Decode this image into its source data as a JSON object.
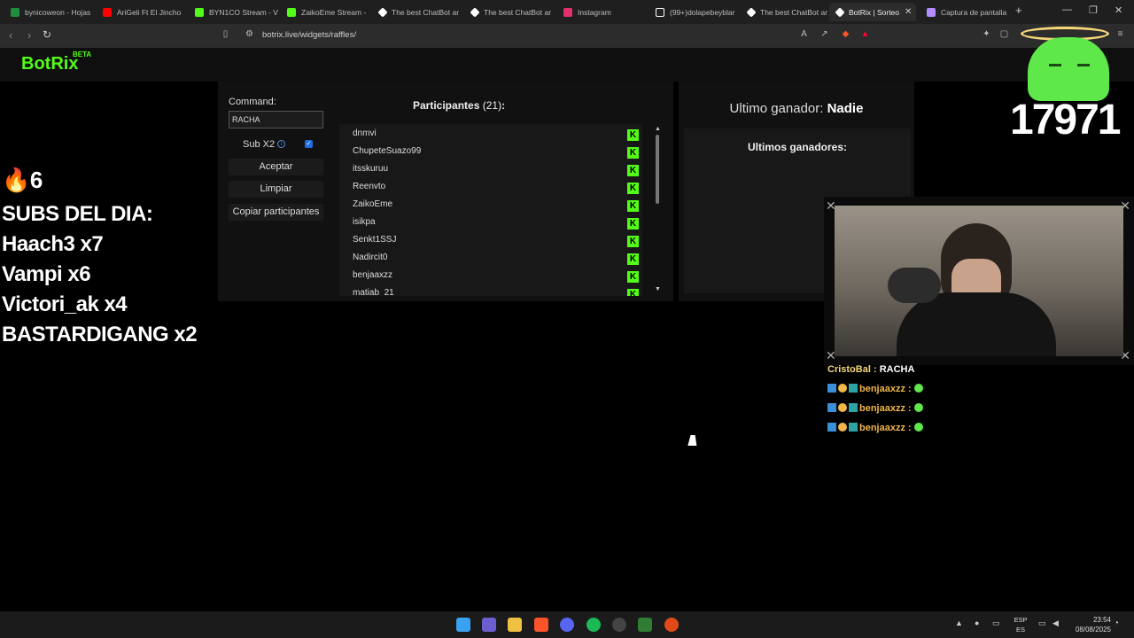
{
  "browser": {
    "tabs": [
      {
        "title": "bynicoweon - Hojas",
        "icon_color": "#1e8e3e"
      },
      {
        "title": "AriGeli Ft El Jincho",
        "icon_color": "#ff0000"
      },
      {
        "title": "BYN1CO Stream - V",
        "icon_color": "#53fc18"
      },
      {
        "title": "ZaikoEme Stream -",
        "icon_color": "#53fc18"
      },
      {
        "title": "The best ChatBot ar",
        "icon_color": "#ffffff"
      },
      {
        "title": "The best ChatBot ar",
        "icon_color": "#ffffff"
      },
      {
        "title": "Instagram",
        "icon_color": "#e1306c"
      },
      {
        "title": "(99+)dolapebeyblar",
        "icon_color": "#ffffff"
      },
      {
        "title": "The best ChatBot ar",
        "icon_color": "#ffffff"
      },
      {
        "title": "BotRix | Sorteo",
        "icon_color": "#ffffff",
        "active": true
      },
      {
        "title": "Captura de pantalla",
        "icon_color": "#b48cff"
      }
    ],
    "new_tab": "+",
    "url": "botrix.live/widgets/raffles/"
  },
  "site": {
    "logo": "BotRix",
    "beta": "BETA"
  },
  "raffle": {
    "command_label": "Command:",
    "command_value": "RACHA",
    "sub_x2_label": "Sub X2",
    "sub_x2_checked": true,
    "accept_label": "Aceptar",
    "clear_label": "Limpiar",
    "copy_label": "Copiar participantes",
    "participants_title": "Participantes",
    "participants_count": "(21)",
    "participants_colon": ":",
    "participants": [
      "dnmvi",
      "ChupeteSuazo99",
      "itsskuruu",
      "Reenvto",
      "ZaikoEme",
      "isikpa",
      "Senkt1SSJ",
      "Nadircit0",
      "benjaaxzz",
      "matiab_21"
    ],
    "platform_icon": "K"
  },
  "winners": {
    "last_winner_label": "Ultimo ganador:",
    "last_winner_value": "Nadie",
    "recent_title": "Ultimos ganadores:"
  },
  "overlay": {
    "fire_count": "🔥6",
    "subs_title": "SUBS DEL DIA:",
    "subs": [
      "Haach3 x7",
      "Vampi x6",
      "Victori_ak x4",
      "BASTARDIGANG x2"
    ],
    "viewer_counter": "17971"
  },
  "chat": [
    {
      "user": "CristoBal",
      "message": "RACHA"
    },
    {
      "user": "benjaaxzz",
      "message": ""
    },
    {
      "user": "benjaaxzz",
      "message": ""
    },
    {
      "user": "benjaaxzz",
      "message": ""
    }
  ],
  "taskbar": {
    "lang_top": "ESP",
    "lang_bottom": "ES",
    "time": "23:54",
    "date": "08/08/2025"
  }
}
